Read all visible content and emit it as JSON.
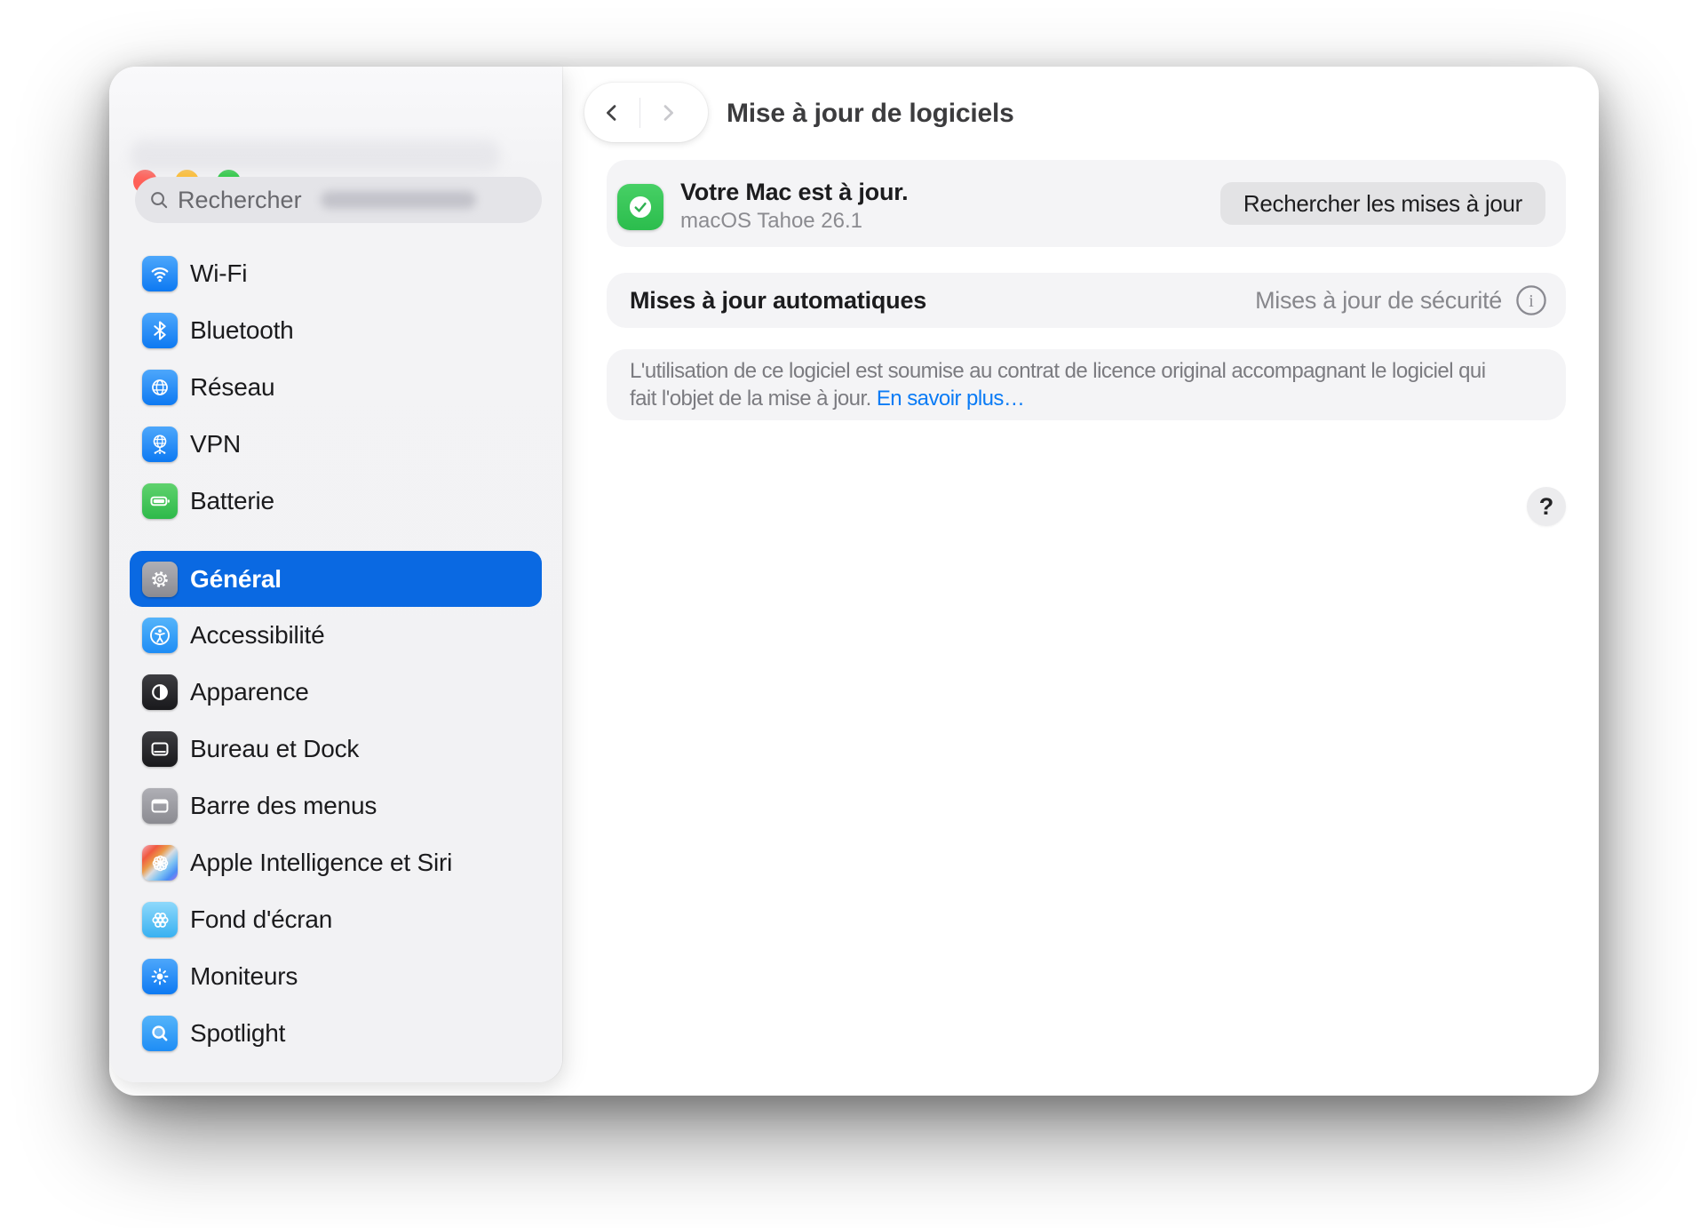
{
  "window": {
    "controls": {
      "close_color": "#ff5f57",
      "minimize_color": "#febc2e",
      "zoom_color": "#28c840"
    },
    "header": {
      "title": "Mise à jour de logiciels"
    }
  },
  "sidebar": {
    "search": {
      "placeholder": "Rechercher"
    },
    "groups": [
      {
        "items": [
          {
            "label": "Wi-Fi",
            "icon": "wifi-icon"
          },
          {
            "label": "Bluetooth",
            "icon": "bluetooth-icon"
          },
          {
            "label": "Réseau",
            "icon": "globe-icon"
          },
          {
            "label": "VPN",
            "icon": "vpn-globe-icon"
          },
          {
            "label": "Batterie",
            "icon": "battery-icon"
          }
        ]
      },
      {
        "items": [
          {
            "label": "Général",
            "icon": "gear-icon",
            "selected": true
          },
          {
            "label": "Accessibilité",
            "icon": "accessibility-icon"
          },
          {
            "label": "Apparence",
            "icon": "appearance-icon"
          },
          {
            "label": "Bureau et Dock",
            "icon": "desktop-dock-icon"
          },
          {
            "label": "Barre des menus",
            "icon": "menu-bar-icon"
          },
          {
            "label": "Apple Intelligence et Siri",
            "icon": "apple-intelligence-icon"
          },
          {
            "label": "Fond d'écran",
            "icon": "wallpaper-icon"
          },
          {
            "label": "Moniteurs",
            "icon": "displays-icon"
          },
          {
            "label": "Spotlight",
            "icon": "spotlight-icon"
          }
        ]
      }
    ]
  },
  "main": {
    "update_card": {
      "title": "Votre Mac est à jour.",
      "subtitle": "macOS Tahoe 26.1",
      "button_label": "Rechercher les mises à jour"
    },
    "auto_updates": {
      "label": "Mises à jour automatiques",
      "value": "Mises à jour de sécurité"
    },
    "license": {
      "line1": "L'utilisation de ce logiciel est soumise au contrat de licence original accompagnant le logiciel qui",
      "line2": "fait l'objet de la mise à jour.",
      "link": "En savoir plus…"
    },
    "help_label": "?"
  },
  "colors": {
    "accent_blue": "#0a69e2",
    "success_green": "#31c859",
    "link_blue": "#0a7bf5",
    "card_gray": "#f4f4f6"
  }
}
